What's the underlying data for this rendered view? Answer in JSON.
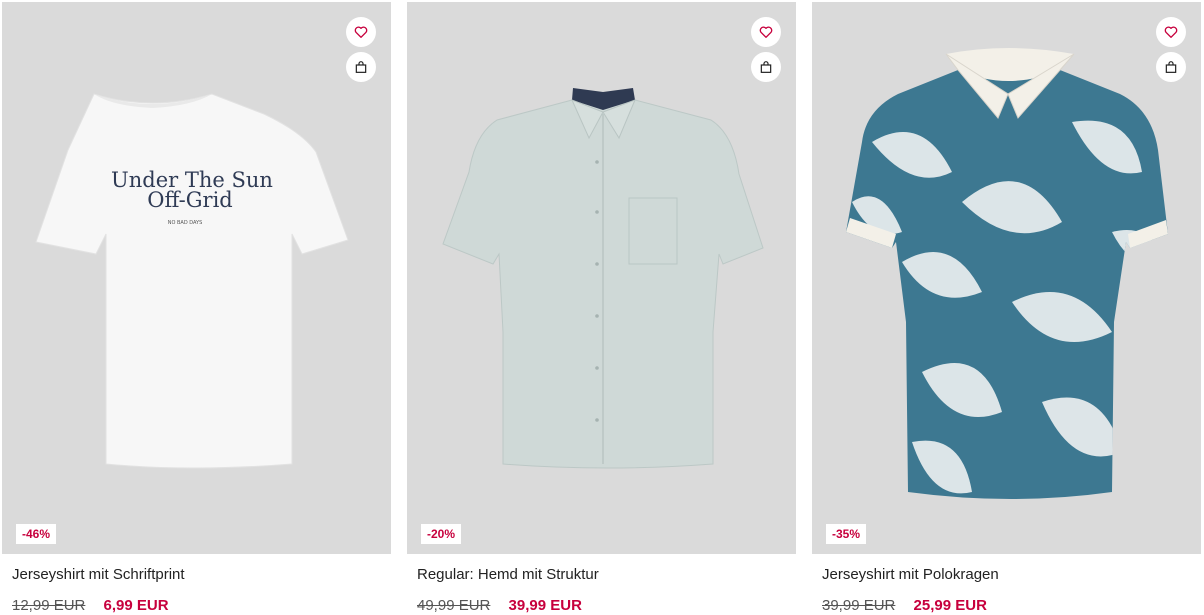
{
  "products": [
    {
      "name": "Jerseyshirt mit Schriftprint",
      "old_price": "12,99 EUR",
      "new_price": "6,99 EUR",
      "discount": "-46%",
      "print_line1": "Under The Sun",
      "print_line2": "Off-Grid",
      "print_small": "NO BAD DAYS"
    },
    {
      "name": "Regular: Hemd mit Struktur",
      "old_price": "49,99 EUR",
      "new_price": "39,99 EUR",
      "discount": "-20%"
    },
    {
      "name": "Jerseyshirt mit Polokragen",
      "old_price": "39,99 EUR",
      "new_price": "25,99 EUR",
      "discount": "-35%"
    }
  ],
  "icons": {
    "wishlist": "heart-icon",
    "cart": "shopping-bag-icon"
  },
  "colors": {
    "accent": "#c7003d",
    "image_bg": "#dadada",
    "shirt_blue": "#3d7891"
  }
}
